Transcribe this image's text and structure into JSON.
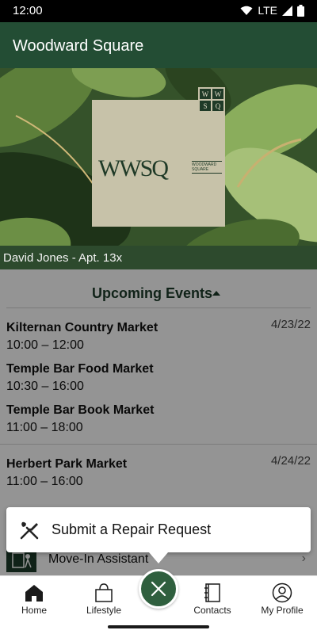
{
  "status_bar": {
    "time": "12:00",
    "network": "LTE"
  },
  "app_bar": {
    "title": "Woodward Square"
  },
  "hero": {
    "logo_text": "WWSQ",
    "logo_subtext": "WOODWARD SQUARE",
    "corner_letters": [
      "W",
      "W",
      "S",
      "Q"
    ],
    "resident": "David Jones - Apt. 13x"
  },
  "events": {
    "title": "Upcoming Events",
    "days": [
      {
        "date": "4/23/22",
        "items": [
          {
            "name": "Kilternan Country Market",
            "time": "10:00 – 12:00"
          },
          {
            "name": "Temple Bar Food Market",
            "time": "10:30 – 16:00"
          },
          {
            "name": "Temple Bar Book Market",
            "time": "11:00 – 18:00"
          }
        ]
      },
      {
        "date": "4/24/22",
        "items": [
          {
            "name": "Herbert Park Market",
            "time": "11:00 – 16:00"
          }
        ]
      }
    ]
  },
  "move_in": {
    "label": "Move-In Assistant"
  },
  "fab_menu": {
    "label": "Submit a Repair Request",
    "icon": "tools-icon"
  },
  "bottom_nav": {
    "items": [
      {
        "label": "Home",
        "icon": "home-icon"
      },
      {
        "label": "Lifestyle",
        "icon": "shopping-bag-icon"
      },
      {
        "label": "Contacts",
        "icon": "address-book-icon"
      },
      {
        "label": "My Profile",
        "icon": "profile-icon"
      }
    ],
    "fab_icon": "close-icon"
  },
  "colors": {
    "primary": "#234d34",
    "fab": "#2f5f3e",
    "accent_text": "#1d3c2a"
  }
}
